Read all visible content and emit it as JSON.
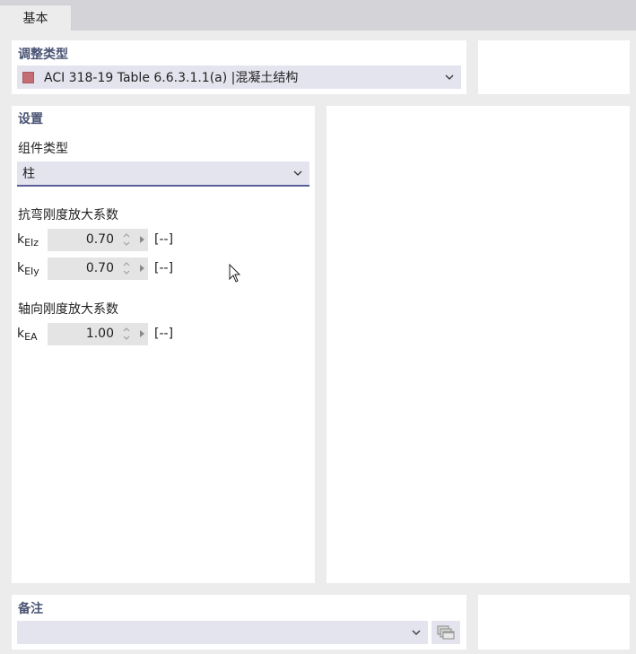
{
  "tabs": [
    {
      "label": "基本"
    }
  ],
  "adjustment_type": {
    "title": "调整类型",
    "selected": "ACI 318-19 Table 6.6.3.1.1(a) |混凝土结构",
    "swatch_color": "#c46e74"
  },
  "settings": {
    "title": "设置",
    "member_type_label": "组件类型",
    "member_type_value": "柱",
    "flexural_label": "抗弯刚度放大系数",
    "axial_label": "轴向刚度放大系数",
    "factors": [
      {
        "symbol_main": "k",
        "symbol_sub": "EIz",
        "value": "0.70",
        "unit": "[--]"
      },
      {
        "symbol_main": "k",
        "symbol_sub": "EIy",
        "value": "0.70",
        "unit": "[--]"
      },
      {
        "symbol_main": "k",
        "symbol_sub": "EA",
        "value": "1.00",
        "unit": "[--]"
      }
    ]
  },
  "comment": {
    "title": "备注",
    "value": ""
  },
  "colors": {
    "accent": "#5a5d9a",
    "section_title": "#4a5475"
  }
}
